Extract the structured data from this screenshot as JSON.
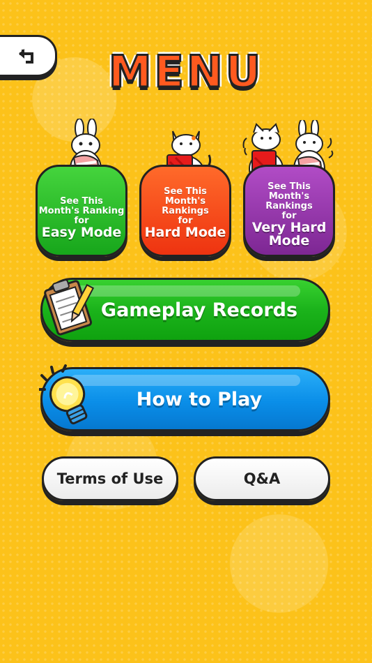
{
  "header": {
    "title": "MENU",
    "back_icon": "return-arrow-icon"
  },
  "rankings": [
    {
      "line1": "See This",
      "line2": "Month's Ranking",
      "line3": "for",
      "mode": "Easy Mode",
      "color": "#1fb21f"
    },
    {
      "line1": "See This",
      "line2": "Month's Rankings",
      "line3": "for",
      "mode": "Hard Mode",
      "color": "#f23f14"
    },
    {
      "line1": "See This",
      "line2": "Month's Rankings",
      "line3": "for",
      "mode_a": "Very Hard",
      "mode_b": "Mode",
      "color": "#8e35a6"
    }
  ],
  "buttons": {
    "records": {
      "label": "Gameplay Records",
      "icon": "clipboard-icon",
      "color": "#1bb31b"
    },
    "howto": {
      "label": "How to Play",
      "icon": "lightbulb-icon",
      "color": "#0a8ee8"
    },
    "terms": {
      "label": "Terms of Use"
    },
    "qa": {
      "label": "Q&A"
    }
  }
}
